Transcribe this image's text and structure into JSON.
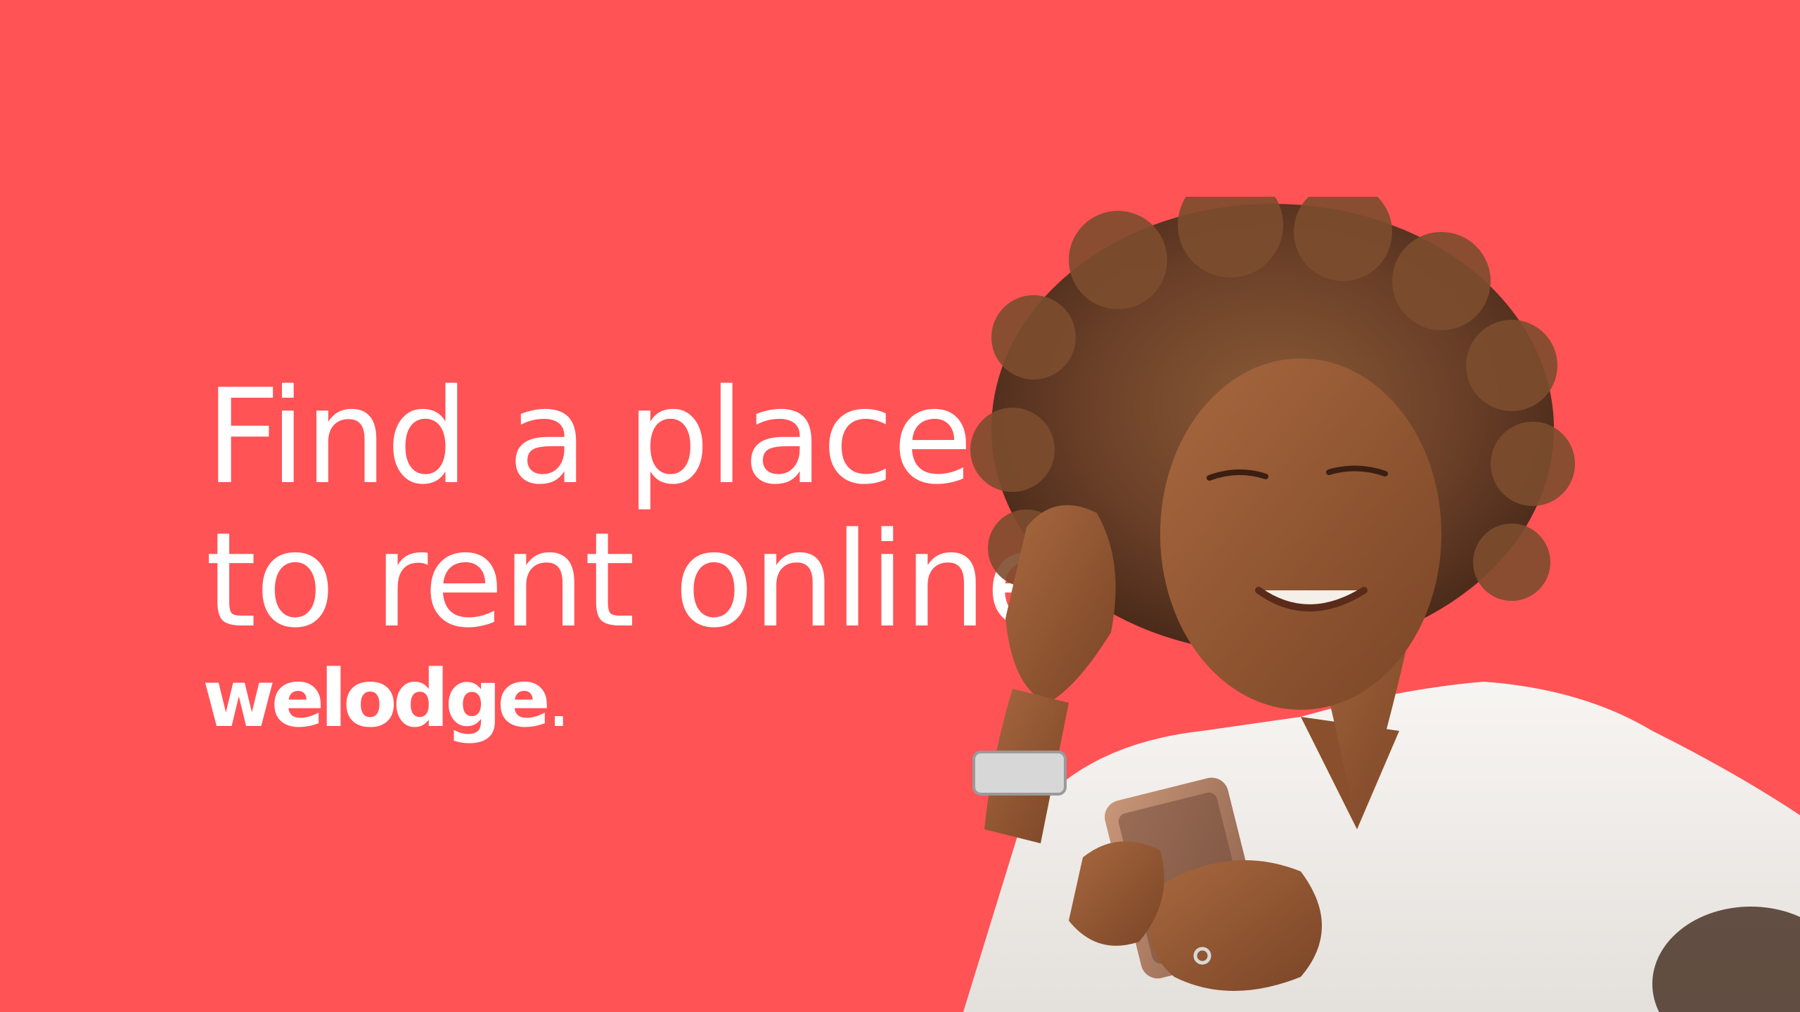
{
  "headline": {
    "line1": "Find a place",
    "line2": "to rent online"
  },
  "brand": {
    "name": "welodge",
    "dot": "."
  },
  "colors": {
    "background": "#ff5356",
    "text": "#ffffff"
  }
}
